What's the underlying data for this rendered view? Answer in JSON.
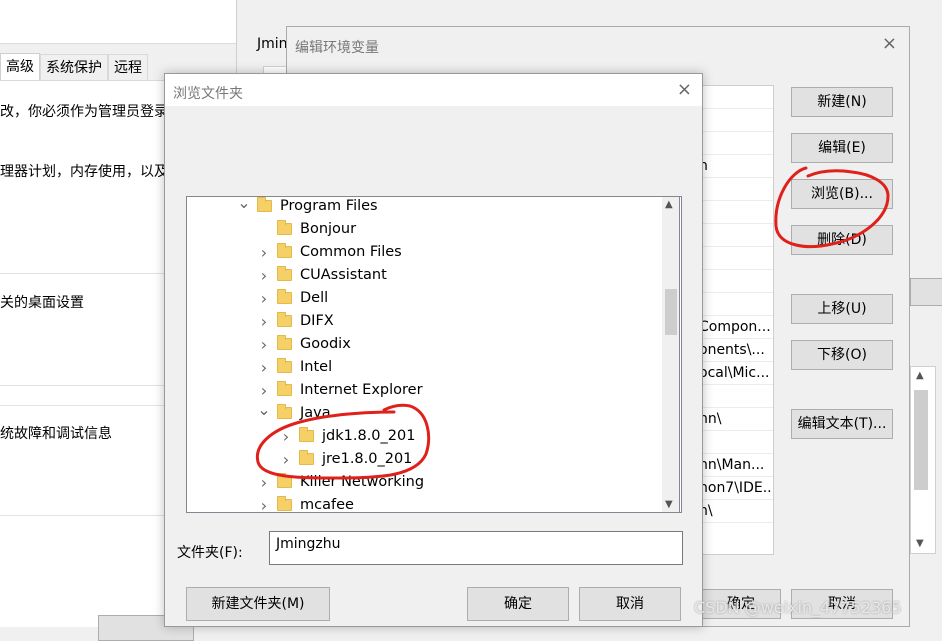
{
  "system_properties": {
    "tabs": [
      "高级",
      "系统保护",
      "远程"
    ],
    "active_tab": "高级",
    "lines": [
      "改，你必须作为管理员登录",
      "理器计划，内存使用，以及虚",
      "关的桌面设置",
      "统故障和调试信息"
    ]
  },
  "env_vars_window": {
    "label_partial": "Jmin"
  },
  "edit_env_dialog": {
    "title": "编辑环境变量",
    "close_glyph": "×",
    "list_rows": [
      "",
      "",
      "",
      "n",
      "",
      "",
      "",
      "",
      "",
      "",
      "Compon...",
      "onents\\...",
      "ocal\\Mic...",
      "",
      "nn\\",
      "",
      "nn\\Man...",
      "non7\\IDE...",
      "n\\"
    ],
    "buttons": {
      "new": "新建(N)",
      "edit": "编辑(E)",
      "browse": "浏览(B)...",
      "delete": "删除(D)",
      "move_up": "上移(U)",
      "move_down": "下移(O)",
      "edit_text": "编辑文本(T)...",
      "ok": "确定",
      "cancel": "取消"
    }
  },
  "browse_dialog": {
    "title": "浏览文件夹",
    "close_glyph": "×",
    "tree": [
      {
        "name": "Program Files",
        "level": 0,
        "expanded": true
      },
      {
        "name": "Bonjour",
        "level": 1,
        "expanded": false,
        "has_children": false
      },
      {
        "name": "Common Files",
        "level": 1,
        "expanded": false,
        "has_children": true
      },
      {
        "name": "CUAssistant",
        "level": 1,
        "expanded": false,
        "has_children": true
      },
      {
        "name": "Dell",
        "level": 1,
        "expanded": false,
        "has_children": true
      },
      {
        "name": "DIFX",
        "level": 1,
        "expanded": false,
        "has_children": true
      },
      {
        "name": "Goodix",
        "level": 1,
        "expanded": false,
        "has_children": true
      },
      {
        "name": "Intel",
        "level": 1,
        "expanded": false,
        "has_children": true
      },
      {
        "name": "Internet Explorer",
        "level": 1,
        "expanded": false,
        "has_children": true
      },
      {
        "name": "Java",
        "level": 1,
        "expanded": true
      },
      {
        "name": "jdk1.8.0_201",
        "level": 2,
        "expanded": false,
        "has_children": true
      },
      {
        "name": "jre1.8.0_201",
        "level": 2,
        "expanded": false,
        "has_children": true
      },
      {
        "name": "Killer Networking",
        "level": 1,
        "expanded": false,
        "has_children": true
      },
      {
        "name": "mcafee",
        "level": 1,
        "expanded": false,
        "has_children": true
      }
    ],
    "folder_label": "文件夹(F):",
    "folder_value": "Jmingzhu",
    "buttons": {
      "new_folder": "新建文件夹(M)",
      "ok": "确定",
      "cancel": "取消"
    }
  },
  "watermark": "CSDN @weixin_47752365",
  "annotation_color": "#e0201a",
  "colors": {
    "folder": "#f4d066",
    "window_bg": "#f0f0f0",
    "button_bg": "#e1e1e1"
  }
}
